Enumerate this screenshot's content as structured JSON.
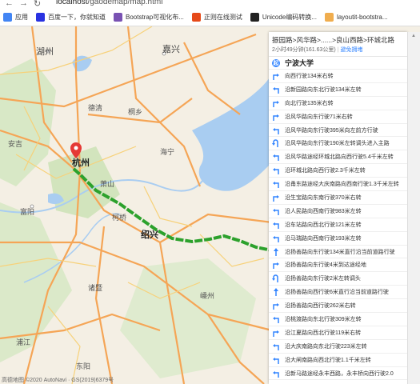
{
  "browser": {
    "url_prefix": "localhost",
    "url_rest": "/gaodemap/map.html"
  },
  "bookmarks": [
    {
      "label": "应用",
      "icon": "apps-grid-icon",
      "color": "#4285f4"
    },
    {
      "label": "百度一下，你就知道",
      "icon": "baidu-paw-icon",
      "color": "#2932e1"
    },
    {
      "label": "Bootstrap可视化布...",
      "icon": "bootstrap-icon",
      "color": "#7952b3"
    },
    {
      "label": "正则在线测试",
      "icon": "regex-icon",
      "color": "#e64a19"
    },
    {
      "label": "Unicode编码转换...",
      "icon": "unicode-icon",
      "color": "#222222"
    },
    {
      "label": "layoutit-bootstra...",
      "icon": "layoutit-icon",
      "color": "#f0ad4e"
    }
  ],
  "map": {
    "labels": {
      "huzhou": "湖州",
      "jiaxing": "嘉兴",
      "hangzhou": "杭州",
      "shaoxing": "绍兴",
      "fuyang": "富阳",
      "anji": "安吉",
      "deqing": "德清",
      "tongxiang": "桐乡",
      "haining": "海宁",
      "xiaoshan": "萧山",
      "keqiao": "柯桥",
      "zhuji": "诸暨",
      "shengzhou": "嵊州",
      "pujiang": "浦江",
      "dongyang": "东阳"
    },
    "footer": "高德地图 ©2020 AutoNavi · GS(2019)6379号",
    "route_color": "#2ca12c"
  },
  "route": {
    "title": "振园路>风华路>......>良山西路>环城北路",
    "meta": "2小时49分钟(161.63公里)",
    "link": "避免拥堵",
    "start": "宁波大学",
    "start_icon_text": "起",
    "steps": [
      {
        "text": "向西行驶134米右转",
        "icon": "turn-right-icon"
      },
      {
        "text": "沿新园路向东北行驶134米左转",
        "icon": "turn-left-icon"
      },
      {
        "text": "向北行驶135米右转",
        "icon": "turn-right-icon"
      },
      {
        "text": "沿风华路向东行驶71米右转",
        "icon": "turn-right-icon"
      },
      {
        "text": "沿风华路向东行驶395米向左前方行驶",
        "icon": "turn-left-icon"
      },
      {
        "text": "沿风华路向东行驶190米左转调头进入主路",
        "icon": "u-turn-icon"
      },
      {
        "text": "沿风华路途经环城北路向西行驶5.4千米左转",
        "icon": "turn-left-icon"
      },
      {
        "text": "沿环城北路向西行驶2.3千米左转",
        "icon": "turn-left-icon"
      },
      {
        "text": "沿甬东路途经大庆南路向西南行驶1.3千米左转",
        "icon": "turn-left-icon"
      },
      {
        "text": "沿生宝路向东南行驶370米右转",
        "icon": "turn-right-icon"
      },
      {
        "text": "沿人民路向西南行驶983米左转",
        "icon": "turn-left-icon"
      },
      {
        "text": "沿车站路向西北行驶121米左转",
        "icon": "turn-left-icon"
      },
      {
        "text": "沿马瑞路向西南行驶193米左转",
        "icon": "turn-left-icon"
      },
      {
        "text": "沿扬善路向东行驶134米直行沿当前道路行驶",
        "icon": "go-straight-icon"
      },
      {
        "text": "沿扬善路向东行驶4米到达途经地",
        "icon": "turn-right-icon"
      },
      {
        "text": "沿扬善路向东行驶2米左转调头",
        "icon": "u-turn-icon"
      },
      {
        "text": "沿扬善路向西行驶6米直行沿当前道路行驶",
        "icon": "go-straight-icon"
      },
      {
        "text": "沿扬善路向西行驶262米右转",
        "icon": "turn-right-icon"
      },
      {
        "text": "沿桃渡路向东北行驶309米左转",
        "icon": "turn-left-icon"
      },
      {
        "text": "沿江夏路向西北行驶119米右转",
        "icon": "turn-right-icon"
      },
      {
        "text": "沿大庆南路向东北行驶223米左转",
        "icon": "turn-left-icon"
      },
      {
        "text": "沿大闸南路向西北行驶1.1千米左转",
        "icon": "turn-left-icon"
      },
      {
        "text": "沿新马路途经永丰西路，永丰桥向西行驶2.0",
        "icon": "turn-left-icon"
      }
    ]
  }
}
